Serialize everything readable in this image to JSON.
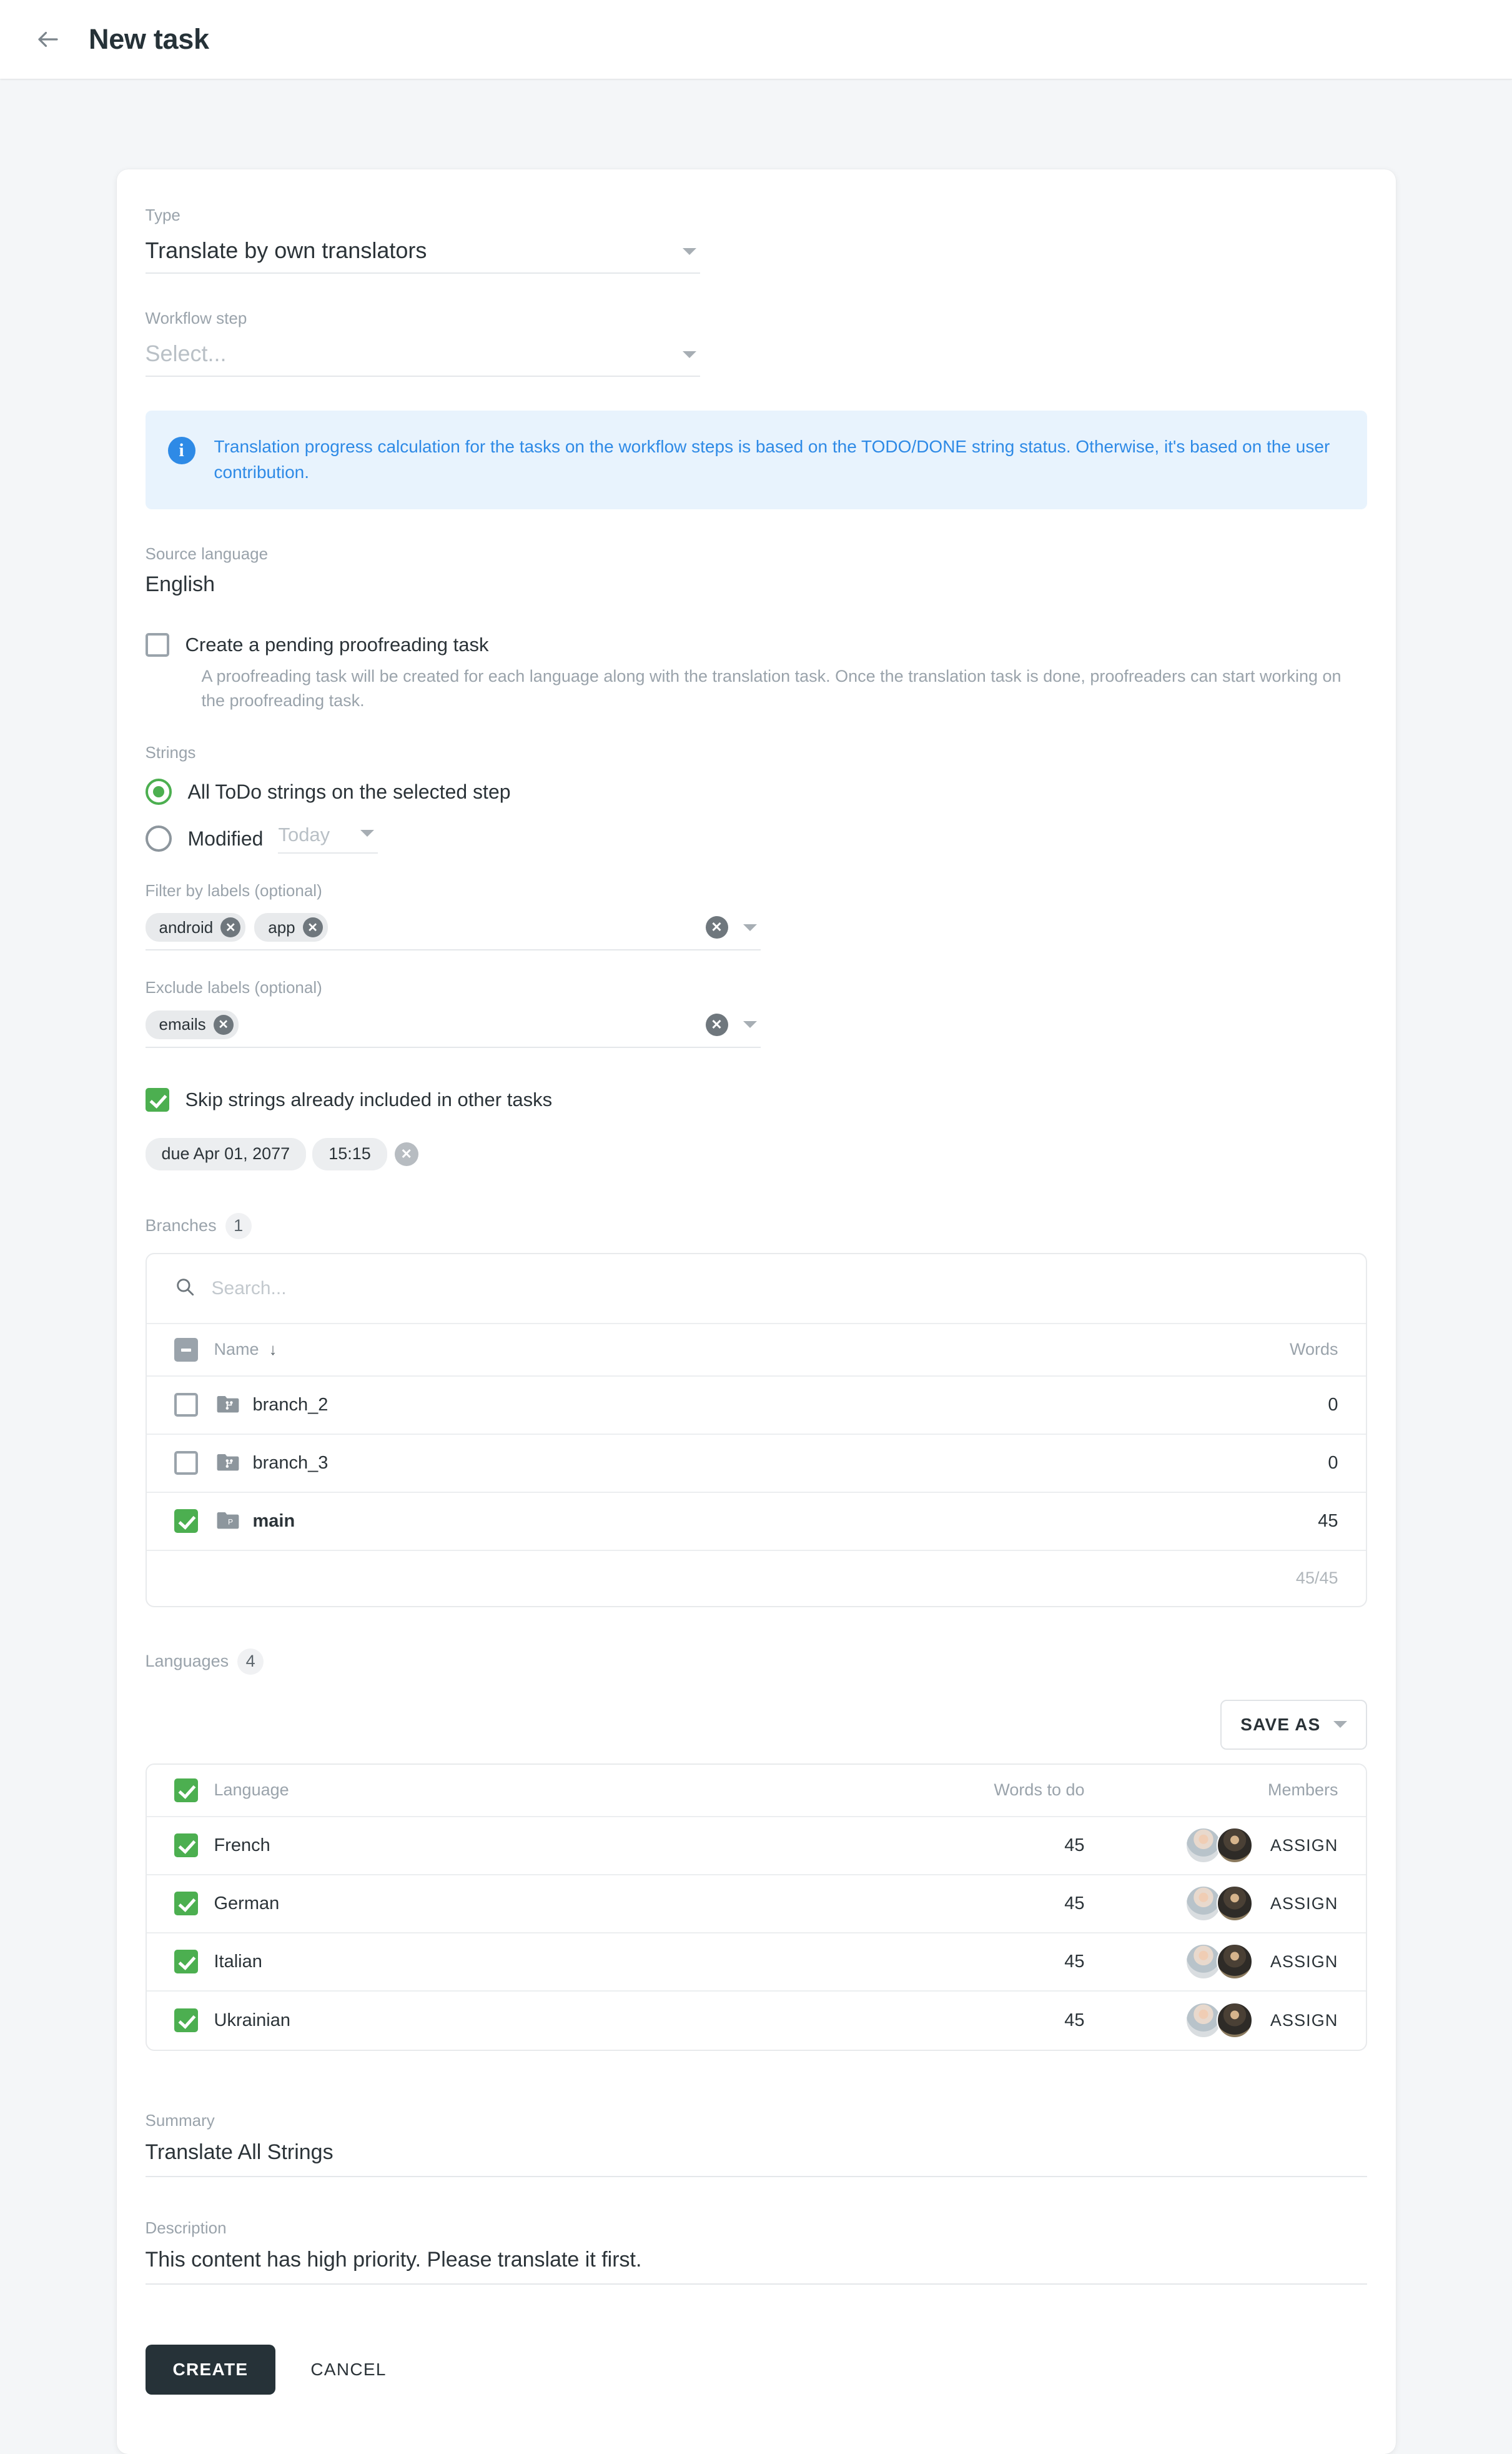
{
  "header": {
    "back_icon": "arrow-left-icon",
    "title": "New task"
  },
  "form": {
    "type": {
      "label": "Type",
      "value": "Translate by own translators"
    },
    "workflow_step": {
      "label": "Workflow step",
      "placeholder": "Select..."
    },
    "banner": {
      "icon": "info-icon",
      "text": "Translation progress calculation for the tasks on the workflow steps is based on the TODO/DONE string status. Otherwise, it's based on the user contribution."
    },
    "source_language": {
      "label": "Source language",
      "value": "English"
    },
    "pending_proofreading": {
      "label": "Create a pending proofreading task",
      "checked": false,
      "help": "A proofreading task will be created for each language along with the translation task. Once the translation task is done, proofreaders can start working on the proofreading task."
    },
    "strings": {
      "label": "Strings",
      "options": [
        {
          "label": "All ToDo strings on the selected step",
          "selected": true
        },
        {
          "label": "Modified",
          "selected": false
        }
      ],
      "modified_value": "Today"
    },
    "filter_labels": {
      "label": "Filter by labels (optional)",
      "chips": [
        "android",
        "app"
      ]
    },
    "exclude_labels": {
      "label": "Exclude labels (optional)",
      "chips": [
        "emails"
      ]
    },
    "skip_strings": {
      "label": "Skip strings already included in other tasks",
      "checked": true
    },
    "due": {
      "date": "due Apr 01, 2077",
      "time": "15:15"
    },
    "summary": {
      "label": "Summary",
      "value": "Translate All Strings"
    },
    "description": {
      "label": "Description",
      "value": "This content has high priority. Please translate it first."
    }
  },
  "branches": {
    "title": "Branches",
    "badge": "1",
    "search_placeholder": "Search...",
    "search_value": "",
    "columns": {
      "name": "Name",
      "words": "Words"
    },
    "header_checkbox_state": "indeterminate",
    "rows": [
      {
        "name": "branch_2",
        "words": "0",
        "checked": false,
        "icon": "branch-folder-icon"
      },
      {
        "name": "branch_3",
        "words": "0",
        "checked": false,
        "icon": "branch-folder-icon"
      },
      {
        "name": "main",
        "words": "45",
        "checked": true,
        "icon": "branch-folder-icon"
      }
    ],
    "footer_total": "45/45"
  },
  "languages": {
    "title": "Languages",
    "badge": "4",
    "save_as_label": "SAVE AS",
    "columns": {
      "language": "Language",
      "words": "Words to do",
      "members": "Members"
    },
    "header_checkbox_state": "checked",
    "assign_label": "ASSIGN",
    "rows": [
      {
        "name": "French",
        "words": "45",
        "checked": true,
        "members": 2
      },
      {
        "name": "German",
        "words": "45",
        "checked": true,
        "members": 2
      },
      {
        "name": "Italian",
        "words": "45",
        "checked": true,
        "members": 2
      },
      {
        "name": "Ukrainian",
        "words": "45",
        "checked": true,
        "members": 2
      }
    ]
  },
  "actions": {
    "create": "CREATE",
    "cancel": "CANCEL"
  },
  "colors": {
    "accent_green": "#4caf50",
    "info_blue": "#2e8ae6",
    "info_bg": "#e8f3fd",
    "dark": "#263238",
    "muted": "#9aa3ab",
    "page_bg": "#f4f6f8"
  }
}
